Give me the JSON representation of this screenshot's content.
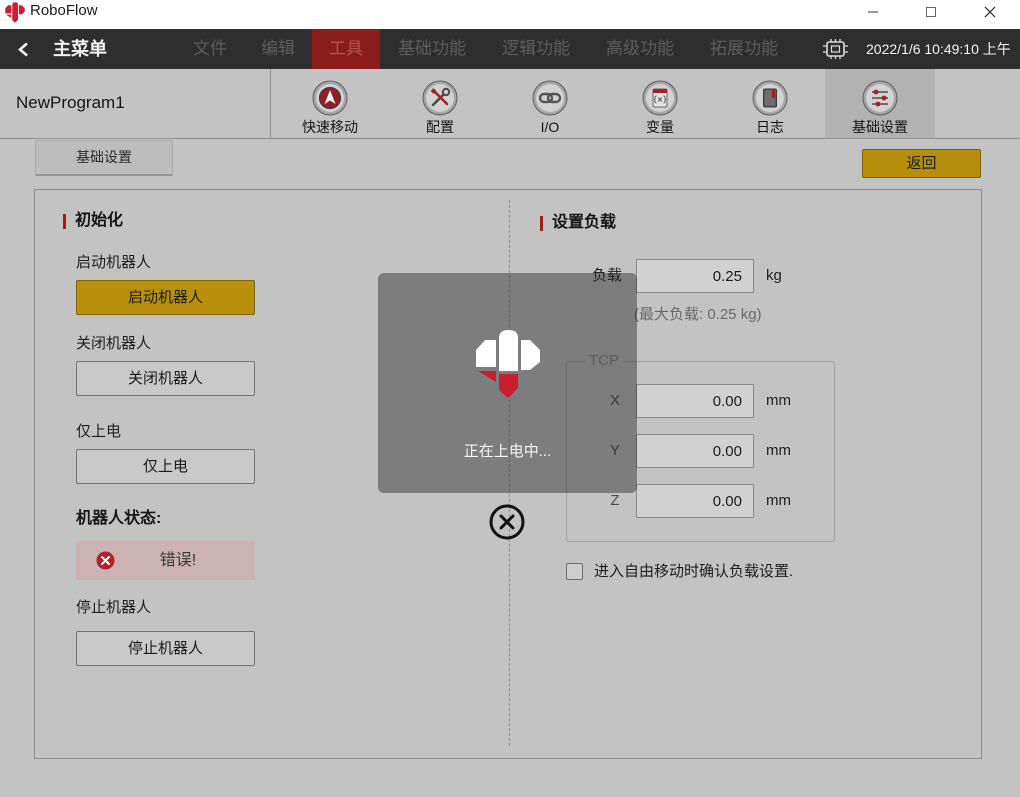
{
  "window": {
    "app_name": "RoboFlow",
    "logo_icon": "roboflow-logo-icon",
    "controls": [
      "minimize-icon",
      "maximize-icon",
      "close-icon"
    ]
  },
  "nav": {
    "back_icon": "chevron-left-icon",
    "title": "主菜单",
    "menu": [
      {
        "label": "文件"
      },
      {
        "label": "编辑"
      },
      {
        "label": "工具",
        "active": true
      },
      {
        "label": "基础功能"
      },
      {
        "label": "逻辑功能"
      },
      {
        "label": "高级功能"
      },
      {
        "label": "拓展功能"
      }
    ],
    "status_icon": "robot-chip-icon",
    "datetime": "2022/1/6 10:49:10 上午"
  },
  "program": {
    "name": "NewProgram1"
  },
  "toolbar": {
    "items": [
      {
        "label": "快速移动",
        "icon": "quick-move-icon"
      },
      {
        "label": "配置",
        "icon": "config-tools-icon"
      },
      {
        "label": "I/O",
        "icon": "io-link-icon"
      },
      {
        "label": "变量",
        "icon": "variable-icon"
      },
      {
        "label": "日志",
        "icon": "log-book-icon"
      },
      {
        "label": "基础设置",
        "icon": "settings-sliders-icon",
        "active": true
      }
    ]
  },
  "page": {
    "tab": "基础设置",
    "back_button": "返回"
  },
  "init": {
    "heading": "初始化",
    "start": {
      "label": "启动机器人",
      "button": "启动机器人"
    },
    "shutdown": {
      "label": "关闭机器人",
      "button": "关闭机器人"
    },
    "power_only": {
      "label": "仅上电",
      "button": "仅上电"
    },
    "status": {
      "label": "机器人状态:",
      "value": "错误!",
      "icon": "error-icon"
    },
    "stop": {
      "label": "停止机器人",
      "button": "停止机器人"
    }
  },
  "payload": {
    "heading": "设置负载",
    "mass_label": "负载",
    "mass_value": "0.25",
    "mass_unit": "kg",
    "max_note": "(最大负载: 0.25 kg)",
    "tcp": {
      "legend": "TCP",
      "fields": [
        {
          "axis": "X",
          "value": "0.00",
          "unit": "mm"
        },
        {
          "axis": "Y",
          "value": "0.00",
          "unit": "mm"
        },
        {
          "axis": "Z",
          "value": "0.00",
          "unit": "mm"
        }
      ]
    },
    "confirm_checkbox": {
      "label": "进入自由移动时确认负载设置.",
      "checked": false
    }
  },
  "modal": {
    "logo_icon": "roboflow-logo-icon",
    "message": "正在上电中...",
    "close_icon": "close-circle-icon"
  },
  "colors": {
    "nav_bg": "#2e2e2e",
    "active_menu": "#8a1c1c",
    "accent_gold": "#b8900b",
    "section_marker": "#a31d1d",
    "error_red": "#b3222c",
    "error_bg": "#ccb2b2",
    "brand_red": "#c81e32"
  }
}
